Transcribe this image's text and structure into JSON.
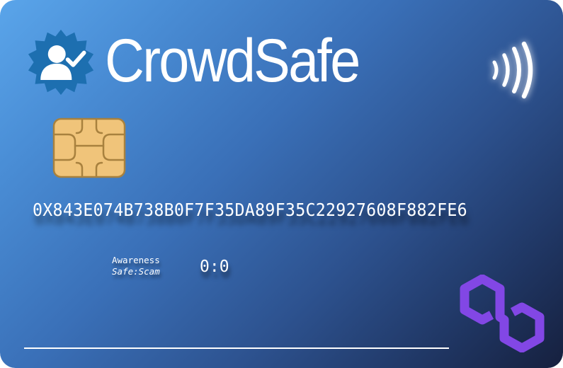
{
  "card": {
    "brand_name": "CrowdSafe",
    "logo_icon": "verified-user-badge-icon",
    "contactless_icon": "contactless-icon",
    "chip_icon": "smart-card-chip-icon",
    "wallet_address": "0X843E074B738B0F7F35DA89F35C22927608F882FE6",
    "awareness": {
      "label": "Awareness",
      "sublabel": "Safe:Scam",
      "score": "0:0"
    },
    "network_logo": "polygon-logo-icon",
    "colors": {
      "gradient_start": "#5aa5ea",
      "gradient_end": "#16203e",
      "badge_blue": "#1d6fb0",
      "chip_gold": "#f0c47a",
      "polygon_purple": "#8247e5"
    }
  }
}
